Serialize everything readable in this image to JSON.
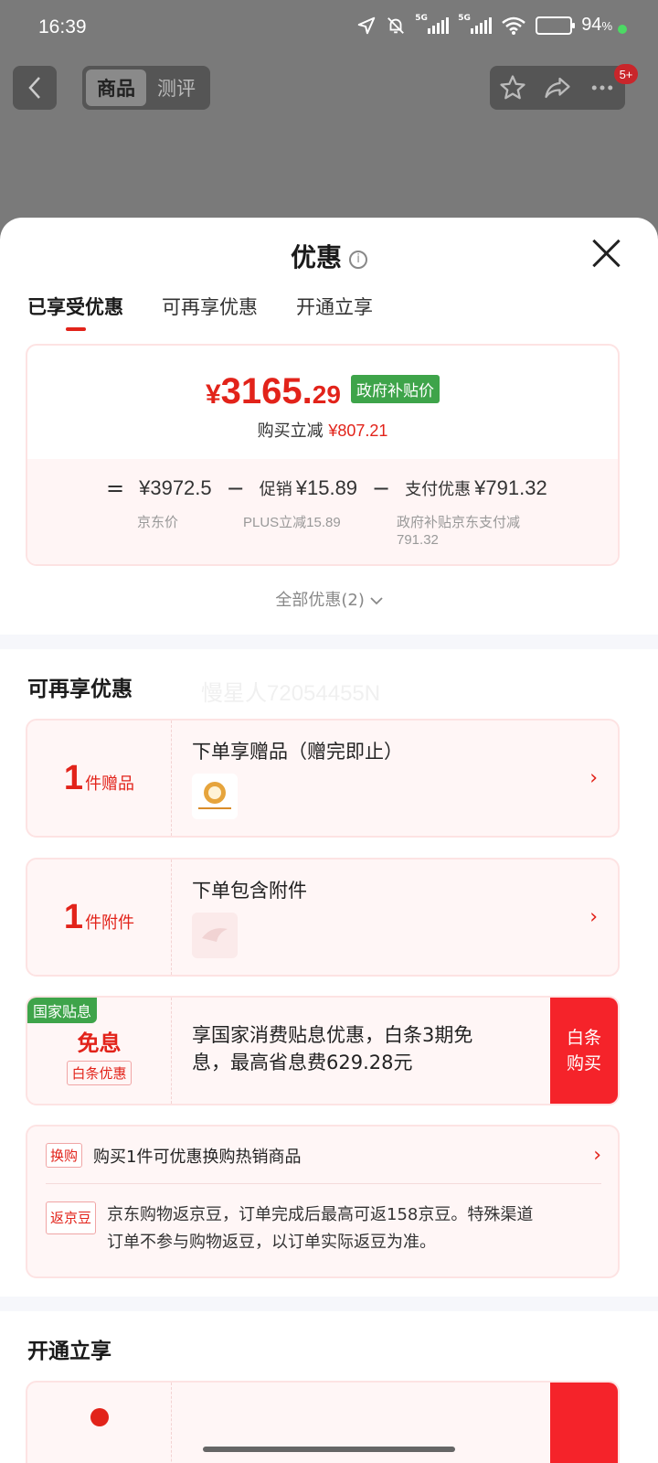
{
  "status_bar": {
    "time": "16:39",
    "network": "5G",
    "battery_percent": "94",
    "battery_level": 0.94,
    "percent_sign": "%"
  },
  "top_nav": {
    "back_icon": "chevron-left-icon",
    "tabs": [
      "商品",
      "测评"
    ],
    "active_tab": 0,
    "actions": [
      "star-icon",
      "share-icon",
      "more-icon"
    ],
    "notification_badge": "5+"
  },
  "sheet": {
    "title": "优惠",
    "info_icon": "info-icon",
    "tabs": [
      "已享受优惠",
      "可再享优惠",
      "开通立享"
    ],
    "active_tab": 0,
    "price_card": {
      "yen": "¥",
      "price_int": "3165.",
      "price_dec": "29",
      "gov_tag": "政府补贴价",
      "reduce_label": "购买立减",
      "reduce_amount": "¥807.21",
      "formula": {
        "eq": "=",
        "base": "¥3972.5",
        "minus1": "−",
        "promo_label": "促销",
        "promo_amount": "¥15.89",
        "minus2": "−",
        "pay_label": "支付优惠",
        "pay_amount": "¥791.32"
      },
      "sublabels": {
        "base": "京东价",
        "promo": "PLUS立减15.89",
        "pay_line1": "政府补贴京东支付减",
        "pay_line2": "791.32"
      }
    },
    "all_benefits": "全部优惠(2)",
    "more_section_title": "可再享优惠",
    "watermark": "慢星人72054455N",
    "offers": [
      {
        "count": "1",
        "unit": "件赠品",
        "title": "下单享赠品（赠完即止）"
      },
      {
        "count": "1",
        "unit": "件附件",
        "title": "下单包含附件"
      }
    ],
    "interest_offer": {
      "tag": "国家贴息",
      "main": "免息",
      "sub": "白条优惠",
      "text_line1": "享国家消费贴息优惠，白条3期免",
      "text_line2": "息，最高省息费629.28元",
      "btn_line1": "白条",
      "btn_line2": "购买"
    },
    "extra": {
      "row1_tag": "换购",
      "row1_text": "购买1件可优惠换购热销商品",
      "row2_tag": "返京豆",
      "row2_line1": "京东购物返京豆，订单完成后最高可返158京豆。特殊渠道",
      "row2_line2": "订单不参与购物返豆，以订单实际返豆为准。"
    },
    "open_section_title": "开通立享"
  },
  "colors": {
    "accent_red": "#e2231a",
    "gov_green": "#3ea44a",
    "card_border": "#fde3e3"
  }
}
